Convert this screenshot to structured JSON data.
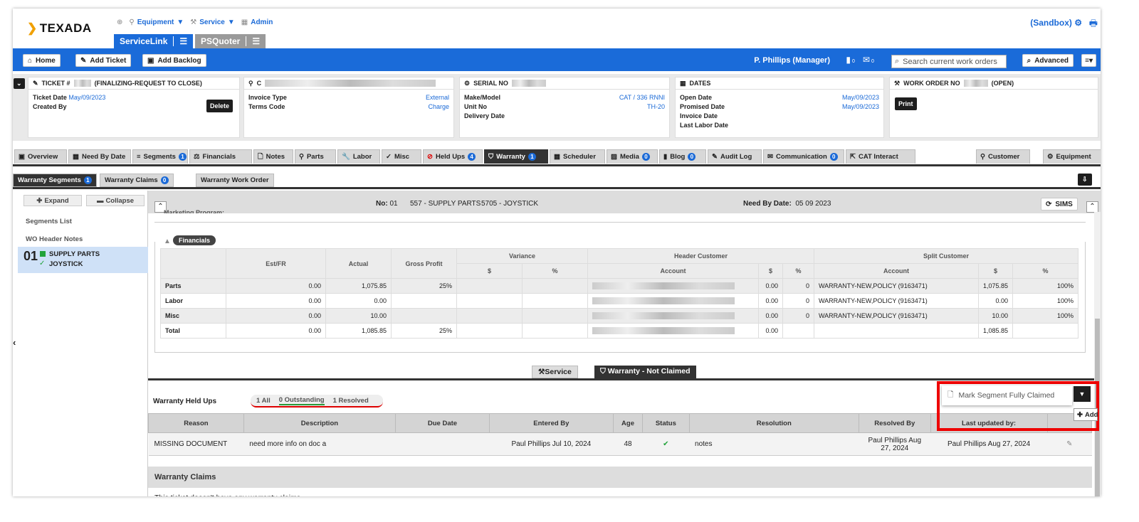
{
  "brand": {
    "name": "TEXADA"
  },
  "topnav": {
    "equipment": "Equipment",
    "service": "Service",
    "admin": "Admin"
  },
  "apps": {
    "servicelink": "ServiceLink",
    "psquoter": "PSQuoter"
  },
  "sandbox": "(Sandbox)",
  "toolbar": {
    "home": "Home",
    "add_ticket": "Add Ticket",
    "add_backlog": "Add Backlog",
    "user": "P. Phillips (Manager)",
    "badge1": "0",
    "badge2": "0",
    "search_placeholder": "Search current work orders",
    "advanced": "Advanced"
  },
  "cards": {
    "ticket": {
      "title": "TICKET #",
      "title2": "(FINALIZING-REQUEST TO CLOSE)",
      "date_label": "Ticket Date",
      "date": "May/09/2023",
      "created": "Created By",
      "delete": "Delete"
    },
    "customer": {
      "title": "C",
      "invoice_type": "Invoice Type",
      "invoice_val": "External",
      "terms": "Terms Code",
      "terms_val": "Charge"
    },
    "serial": {
      "title": "SERIAL NO",
      "make": "Make/Model",
      "make_val": "CAT / 336 RNNI",
      "unit": "Unit No",
      "unit_val": "TH-20",
      "delivery": "Delivery Date"
    },
    "dates": {
      "title": "DATES",
      "open": "Open Date",
      "open_val": "May/09/2023",
      "promised": "Promised Date",
      "promised_val": "May/09/2023",
      "invoice": "Invoice Date",
      "last": "Last Labor Date"
    },
    "wo": {
      "title": "WORK ORDER NO",
      "title2": "(OPEN)",
      "print": "Print"
    }
  },
  "tabs": [
    {
      "label": "Overview"
    },
    {
      "label": "Need By Date"
    },
    {
      "label": "Segments",
      "badge": "1"
    },
    {
      "label": "Financials"
    },
    {
      "label": "Notes"
    },
    {
      "label": "Parts"
    },
    {
      "label": "Labor"
    },
    {
      "label": "Misc"
    },
    {
      "label": "Held Ups",
      "badge": "4"
    },
    {
      "label": "Warranty",
      "badge": "1"
    },
    {
      "label": "Scheduler"
    },
    {
      "label": "Media",
      "badge": "0"
    },
    {
      "label": "Blog",
      "badge": "0"
    },
    {
      "label": "Audit Log"
    },
    {
      "label": "Communication",
      "badge": "0"
    },
    {
      "label": "CAT Interact"
    },
    {
      "label": "Customer"
    },
    {
      "label": "Equipment"
    }
  ],
  "subtabs": {
    "segments": "Warranty Segments",
    "segments_badge": "1",
    "claims": "Warranty Claims",
    "claims_badge": "0",
    "workorder": "Warranty Work Order"
  },
  "left": {
    "expand": "Expand",
    "collapse": "Collapse",
    "segments_list": "Segments List",
    "wo_notes": "WO Header Notes",
    "seg_no": "01",
    "seg_name": "SUPPLY PARTS",
    "seg_sub": "JOYSTICK"
  },
  "segbar": {
    "no_label": "No:",
    "no": "01",
    "desc": "557 - SUPPLY PARTS",
    "job": "5705 - JOYSTICK",
    "need_label": "Need By Date:",
    "need": "05 09 2023",
    "sims": "SIMS",
    "marketing": "Marketing Program:"
  },
  "financials": {
    "title": "Financials",
    "headers": {
      "estfr": "Est/FR",
      "actual": "Actual",
      "gross": "Gross Profit",
      "variance": "Variance",
      "header_customer": "Header Customer",
      "split_customer": "Split Customer",
      "dollar": "$",
      "pct": "%",
      "account": "Account"
    },
    "rows": [
      {
        "label": "Parts",
        "est": "0.00",
        "actual": "1,075.85",
        "gp": "25%",
        "hc_d": "0.00",
        "hc_p": "0",
        "split_acct": "WARRANTY-NEW,POLICY (9163471)",
        "sp_d": "1,075.85",
        "sp_p": "100%"
      },
      {
        "label": "Labor",
        "est": "0.00",
        "actual": "0.00",
        "gp": "",
        "hc_d": "0.00",
        "hc_p": "0",
        "split_acct": "WARRANTY-NEW,POLICY (9163471)",
        "sp_d": "0.00",
        "sp_p": "100%"
      },
      {
        "label": "Misc",
        "est": "0.00",
        "actual": "10.00",
        "gp": "",
        "hc_d": "0.00",
        "hc_p": "0",
        "split_acct": "WARRANTY-NEW,POLICY (9163471)",
        "sp_d": "10.00",
        "sp_p": "100%"
      },
      {
        "label": "Total",
        "est": "0.00",
        "actual": "1,085.85",
        "gp": "25%",
        "hc_d": "0.00",
        "hc_p": "",
        "split_acct": "",
        "sp_d": "1,085.85",
        "sp_p": ""
      }
    ]
  },
  "modes": {
    "service": "Service",
    "warranty": "Warranty - Not Claimed"
  },
  "held": {
    "title": "Warranty Held Ups",
    "all": "1 All",
    "outstanding": "0 Outstanding",
    "resolved": "1 Resolved",
    "mark": "Mark Segment Fully Claimed",
    "add": "Add",
    "headers": [
      "Reason",
      "Description",
      "Due Date",
      "Entered By",
      "Age",
      "Status",
      "Resolution",
      "Resolved By",
      "Last updated by:"
    ],
    "rows": [
      {
        "reason": "MISSING DOCUMENT",
        "description": "need more info on doc a",
        "due": "",
        "entered": "Paul Phillips Jul 10, 2024",
        "age": "48",
        "resolution": "notes",
        "resolved_by": "Paul Phillips Aug 27, 2024",
        "last": "Paul Phillips Aug 27, 2024"
      }
    ]
  },
  "claims": {
    "title": "Warranty Claims",
    "empty": "This ticket doesn't have any warranty claims"
  },
  "colors": {
    "accent": "#1a6bd9",
    "highlight": "#e00000"
  }
}
